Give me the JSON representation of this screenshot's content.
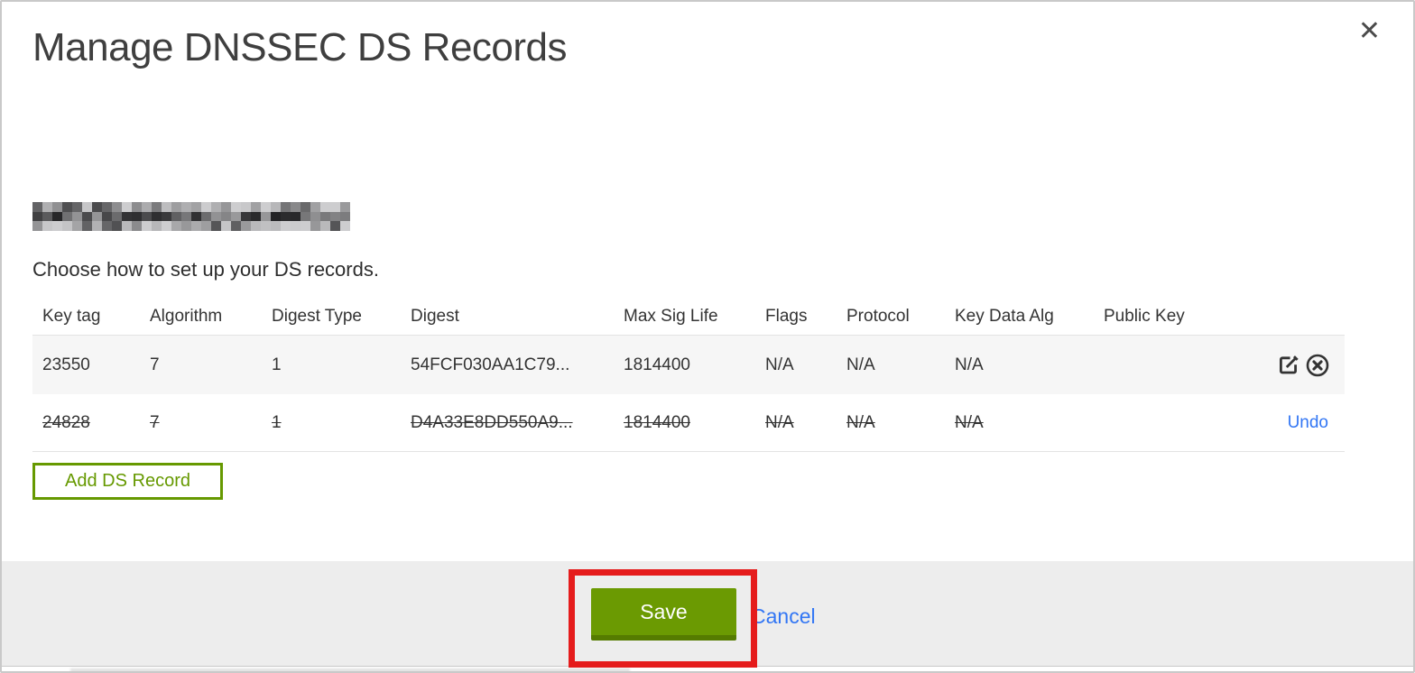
{
  "modal": {
    "title": "Manage DNSSEC DS Records",
    "instruction": "Choose how to set up your DS records.",
    "table": {
      "headers": [
        "Key tag",
        "Algorithm",
        "Digest Type",
        "Digest",
        "Max Sig Life",
        "Flags",
        "Protocol",
        "Key Data Alg",
        "Public Key"
      ],
      "rows": [
        {
          "cells": [
            "23550",
            "7",
            "1",
            "54FCF030AA1C79...",
            "1814400",
            "N/A",
            "N/A",
            "N/A",
            ""
          ],
          "deleted": false
        },
        {
          "cells": [
            "24828",
            "7",
            "1",
            "D4A33E8DD550A9...",
            "1814400",
            "N/A",
            "N/A",
            "N/A",
            ""
          ],
          "deleted": true,
          "undo_label": "Undo"
        }
      ]
    },
    "add_button_label": "Add DS Record",
    "footer": {
      "save_label": "Save",
      "cancel_label": "Cancel"
    }
  },
  "icons": {
    "close": "✕"
  },
  "colors": {
    "accent_green": "#669900",
    "save_green": "#6b9a02",
    "link_blue": "#3276f4",
    "annotation_red": "#e51c1c",
    "footer_gray": "#ededed",
    "row_gray": "#f6f6f6"
  }
}
